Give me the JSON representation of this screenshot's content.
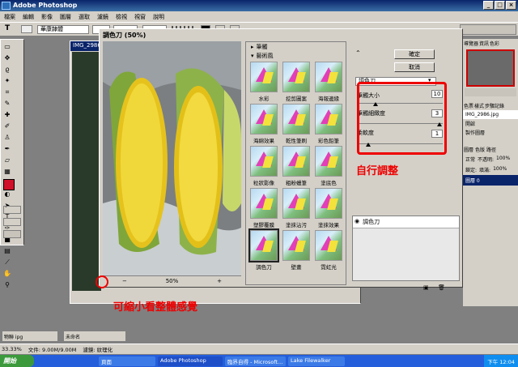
{
  "app": {
    "title": "Adobe Photoshop"
  },
  "menu": [
    "檔案",
    "編輯",
    "影像",
    "圖層",
    "選取",
    "濾鏡",
    "檢視",
    "視窗",
    "說明"
  ],
  "options": {
    "font_family": "華康隸體",
    "tool_letter": "T"
  },
  "document": {
    "title": "IMG_2986"
  },
  "dialog": {
    "title": "調色刀 (50%)",
    "zoom": "50%",
    "ok_label": "確定",
    "cancel_label": "取消",
    "filter_select": "調色刀",
    "folders": [
      "筆觸",
      "藝術風"
    ],
    "thumbnails": [
      "水彩",
      "挖剪圖案",
      "海報邊緣",
      "海綿效果",
      "乾性筆刷",
      "彩色鉛筆",
      "粒狀影像",
      "粗粉蠟筆",
      "塗底色",
      "塑膠覆膜",
      "塗抹沾污",
      "塗抹效果",
      "調色刀",
      "壁畫",
      "霓虹光"
    ],
    "selected_thumbnail": "調色刀",
    "params": [
      {
        "label": "筆觸大小",
        "value": "10",
        "level": 0.2
      },
      {
        "label": "筆觸細緻度",
        "value": "3",
        "level": 0.95
      },
      {
        "label": "柔軟度",
        "value": "1",
        "level": 0.12
      }
    ],
    "layer_item": "調色刀"
  },
  "right_panel": {
    "tabs1": [
      "導覽器",
      "資訊",
      "色彩"
    ],
    "tabs2": [
      "色票",
      "樣式",
      "步驟記錄"
    ],
    "history_item": "IMG_2986.jpg",
    "history_items": [
      "開啟",
      "製作圖層"
    ],
    "tabs3": [
      "圖層",
      "色版",
      "路徑"
    ],
    "blend_mode": "正常",
    "opacity_label": "不透明:",
    "opacity_value": "100%",
    "fill_label": "填滿:",
    "fill_value": "100%",
    "lock_label": "鎖定:",
    "layer_name": "圖層 0"
  },
  "status": {
    "zoom": "33.33%",
    "doc": "文件: 9.00M/9.00M",
    "message": "濾鏡: 紋理化"
  },
  "minimized": [
    "物聯 ipg",
    "未命名"
  ],
  "taskbar": {
    "start": "開始",
    "items": [
      "頁面",
      "Adobe Photoshop",
      "臨界自得 - Microsoft...",
      "Lake Filewalker"
    ],
    "clock": "下午 12:04"
  },
  "annotations": {
    "adjust": "自行調整",
    "zoom_hint": "可縮小看整體感覺"
  },
  "colors": {
    "accent": "#e00000",
    "title_bar": "#0a246a",
    "taskbar": "#245edb"
  }
}
